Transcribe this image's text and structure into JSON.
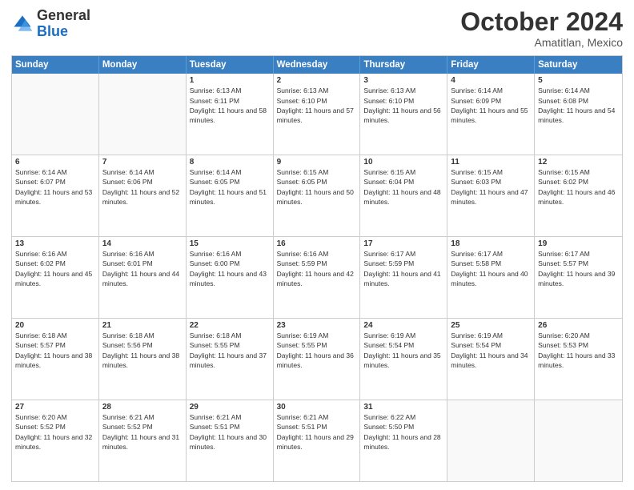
{
  "logo": {
    "general": "General",
    "blue": "Blue"
  },
  "header": {
    "month": "October 2024",
    "location": "Amatitlan, Mexico"
  },
  "weekdays": [
    "Sunday",
    "Monday",
    "Tuesday",
    "Wednesday",
    "Thursday",
    "Friday",
    "Saturday"
  ],
  "weeks": [
    [
      {
        "day": "",
        "empty": true
      },
      {
        "day": "",
        "empty": true
      },
      {
        "day": "1",
        "sunrise": "Sunrise: 6:13 AM",
        "sunset": "Sunset: 6:11 PM",
        "daylight": "Daylight: 11 hours and 58 minutes."
      },
      {
        "day": "2",
        "sunrise": "Sunrise: 6:13 AM",
        "sunset": "Sunset: 6:10 PM",
        "daylight": "Daylight: 11 hours and 57 minutes."
      },
      {
        "day": "3",
        "sunrise": "Sunrise: 6:13 AM",
        "sunset": "Sunset: 6:10 PM",
        "daylight": "Daylight: 11 hours and 56 minutes."
      },
      {
        "day": "4",
        "sunrise": "Sunrise: 6:14 AM",
        "sunset": "Sunset: 6:09 PM",
        "daylight": "Daylight: 11 hours and 55 minutes."
      },
      {
        "day": "5",
        "sunrise": "Sunrise: 6:14 AM",
        "sunset": "Sunset: 6:08 PM",
        "daylight": "Daylight: 11 hours and 54 minutes."
      }
    ],
    [
      {
        "day": "6",
        "sunrise": "Sunrise: 6:14 AM",
        "sunset": "Sunset: 6:07 PM",
        "daylight": "Daylight: 11 hours and 53 minutes."
      },
      {
        "day": "7",
        "sunrise": "Sunrise: 6:14 AM",
        "sunset": "Sunset: 6:06 PM",
        "daylight": "Daylight: 11 hours and 52 minutes."
      },
      {
        "day": "8",
        "sunrise": "Sunrise: 6:14 AM",
        "sunset": "Sunset: 6:05 PM",
        "daylight": "Daylight: 11 hours and 51 minutes."
      },
      {
        "day": "9",
        "sunrise": "Sunrise: 6:15 AM",
        "sunset": "Sunset: 6:05 PM",
        "daylight": "Daylight: 11 hours and 50 minutes."
      },
      {
        "day": "10",
        "sunrise": "Sunrise: 6:15 AM",
        "sunset": "Sunset: 6:04 PM",
        "daylight": "Daylight: 11 hours and 48 minutes."
      },
      {
        "day": "11",
        "sunrise": "Sunrise: 6:15 AM",
        "sunset": "Sunset: 6:03 PM",
        "daylight": "Daylight: 11 hours and 47 minutes."
      },
      {
        "day": "12",
        "sunrise": "Sunrise: 6:15 AM",
        "sunset": "Sunset: 6:02 PM",
        "daylight": "Daylight: 11 hours and 46 minutes."
      }
    ],
    [
      {
        "day": "13",
        "sunrise": "Sunrise: 6:16 AM",
        "sunset": "Sunset: 6:02 PM",
        "daylight": "Daylight: 11 hours and 45 minutes."
      },
      {
        "day": "14",
        "sunrise": "Sunrise: 6:16 AM",
        "sunset": "Sunset: 6:01 PM",
        "daylight": "Daylight: 11 hours and 44 minutes."
      },
      {
        "day": "15",
        "sunrise": "Sunrise: 6:16 AM",
        "sunset": "Sunset: 6:00 PM",
        "daylight": "Daylight: 11 hours and 43 minutes."
      },
      {
        "day": "16",
        "sunrise": "Sunrise: 6:16 AM",
        "sunset": "Sunset: 5:59 PM",
        "daylight": "Daylight: 11 hours and 42 minutes."
      },
      {
        "day": "17",
        "sunrise": "Sunrise: 6:17 AM",
        "sunset": "Sunset: 5:59 PM",
        "daylight": "Daylight: 11 hours and 41 minutes."
      },
      {
        "day": "18",
        "sunrise": "Sunrise: 6:17 AM",
        "sunset": "Sunset: 5:58 PM",
        "daylight": "Daylight: 11 hours and 40 minutes."
      },
      {
        "day": "19",
        "sunrise": "Sunrise: 6:17 AM",
        "sunset": "Sunset: 5:57 PM",
        "daylight": "Daylight: 11 hours and 39 minutes."
      }
    ],
    [
      {
        "day": "20",
        "sunrise": "Sunrise: 6:18 AM",
        "sunset": "Sunset: 5:57 PM",
        "daylight": "Daylight: 11 hours and 38 minutes."
      },
      {
        "day": "21",
        "sunrise": "Sunrise: 6:18 AM",
        "sunset": "Sunset: 5:56 PM",
        "daylight": "Daylight: 11 hours and 38 minutes."
      },
      {
        "day": "22",
        "sunrise": "Sunrise: 6:18 AM",
        "sunset": "Sunset: 5:55 PM",
        "daylight": "Daylight: 11 hours and 37 minutes."
      },
      {
        "day": "23",
        "sunrise": "Sunrise: 6:19 AM",
        "sunset": "Sunset: 5:55 PM",
        "daylight": "Daylight: 11 hours and 36 minutes."
      },
      {
        "day": "24",
        "sunrise": "Sunrise: 6:19 AM",
        "sunset": "Sunset: 5:54 PM",
        "daylight": "Daylight: 11 hours and 35 minutes."
      },
      {
        "day": "25",
        "sunrise": "Sunrise: 6:19 AM",
        "sunset": "Sunset: 5:54 PM",
        "daylight": "Daylight: 11 hours and 34 minutes."
      },
      {
        "day": "26",
        "sunrise": "Sunrise: 6:20 AM",
        "sunset": "Sunset: 5:53 PM",
        "daylight": "Daylight: 11 hours and 33 minutes."
      }
    ],
    [
      {
        "day": "27",
        "sunrise": "Sunrise: 6:20 AM",
        "sunset": "Sunset: 5:52 PM",
        "daylight": "Daylight: 11 hours and 32 minutes."
      },
      {
        "day": "28",
        "sunrise": "Sunrise: 6:21 AM",
        "sunset": "Sunset: 5:52 PM",
        "daylight": "Daylight: 11 hours and 31 minutes."
      },
      {
        "day": "29",
        "sunrise": "Sunrise: 6:21 AM",
        "sunset": "Sunset: 5:51 PM",
        "daylight": "Daylight: 11 hours and 30 minutes."
      },
      {
        "day": "30",
        "sunrise": "Sunrise: 6:21 AM",
        "sunset": "Sunset: 5:51 PM",
        "daylight": "Daylight: 11 hours and 29 minutes."
      },
      {
        "day": "31",
        "sunrise": "Sunrise: 6:22 AM",
        "sunset": "Sunset: 5:50 PM",
        "daylight": "Daylight: 11 hours and 28 minutes."
      },
      {
        "day": "",
        "empty": true
      },
      {
        "day": "",
        "empty": true
      }
    ]
  ]
}
